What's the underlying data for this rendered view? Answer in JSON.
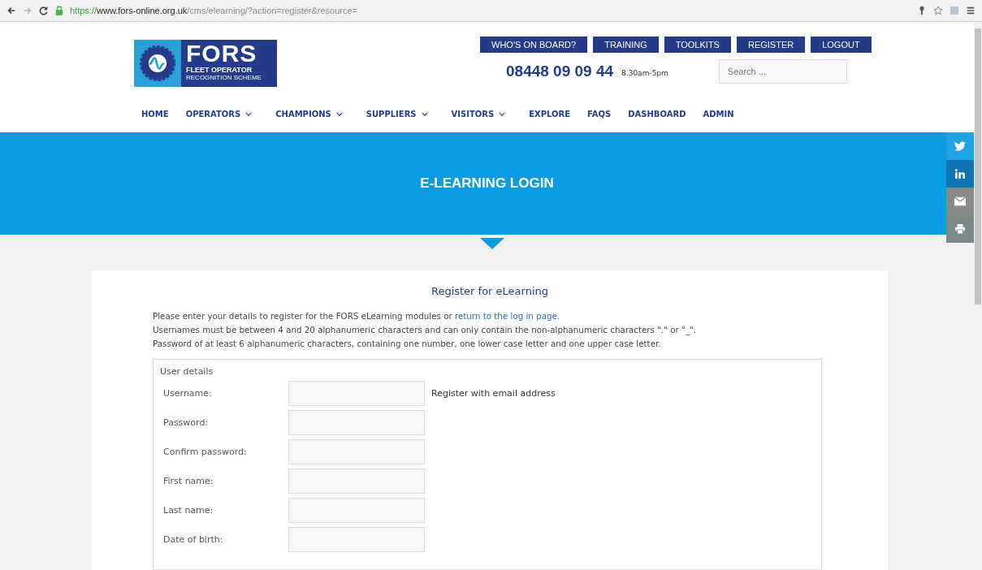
{
  "browser": {
    "url": {
      "scheme": "https://",
      "host": "www.fors-online.org.uk",
      "path": "/cms/elearning/?action=register&resource="
    }
  },
  "logo": {
    "title": "FORS",
    "line_1": "FLEET OPERATOR",
    "line_2": "RECOGNITION SCHEME"
  },
  "top_buttons": [
    "WHO'S ON BOARD?",
    "TRAINING",
    "TOOLKITS",
    "REGISTER",
    "LOGOUT"
  ],
  "phone": "08448 09 09 44",
  "hours": "8.30am-5pm",
  "search": {
    "placeholder": "Search ..."
  },
  "nav": [
    {
      "label": "HOME",
      "dropdown": false
    },
    {
      "label": "OPERATORS",
      "dropdown": true
    },
    {
      "label": "CHAMPIONS",
      "dropdown": true
    },
    {
      "label": "SUPPLIERS",
      "dropdown": true
    },
    {
      "label": "VISITORS",
      "dropdown": true
    },
    {
      "label": "EXPLORE",
      "dropdown": false
    },
    {
      "label": "FAQS",
      "dropdown": false
    },
    {
      "label": "DASHBOARD",
      "dropdown": false
    },
    {
      "label": "ADMIN",
      "dropdown": false
    }
  ],
  "banner": {
    "title": "E-LEARNING LOGIN"
  },
  "share": [
    {
      "kind": "twitter"
    },
    {
      "kind": "linkedin"
    },
    {
      "kind": "email"
    },
    {
      "kind": "print"
    }
  ],
  "content": {
    "heading": "Register for eLearning",
    "intro": "Please enter your details to register for the FORS eLearning modules or",
    "intro_link": "return to the log in page.",
    "rules": [
      "Usernames must be between 4 and 20 alphanumeric characters and can only contain the non-alphanumeric characters \".\" or \"_\".",
      "Password of at least 6 alphanumeric characters, containing one number, one lower case letter and one upper case letter."
    ],
    "fieldset": {
      "legend": "User details",
      "rows": [
        {
          "label": "Username:",
          "note": "Register with email address"
        },
        {
          "label": "Password:"
        },
        {
          "label": "Confirm password:"
        },
        {
          "label": "First name:"
        },
        {
          "label": "Last name:"
        },
        {
          "label": "Date of birth:"
        }
      ]
    }
  }
}
